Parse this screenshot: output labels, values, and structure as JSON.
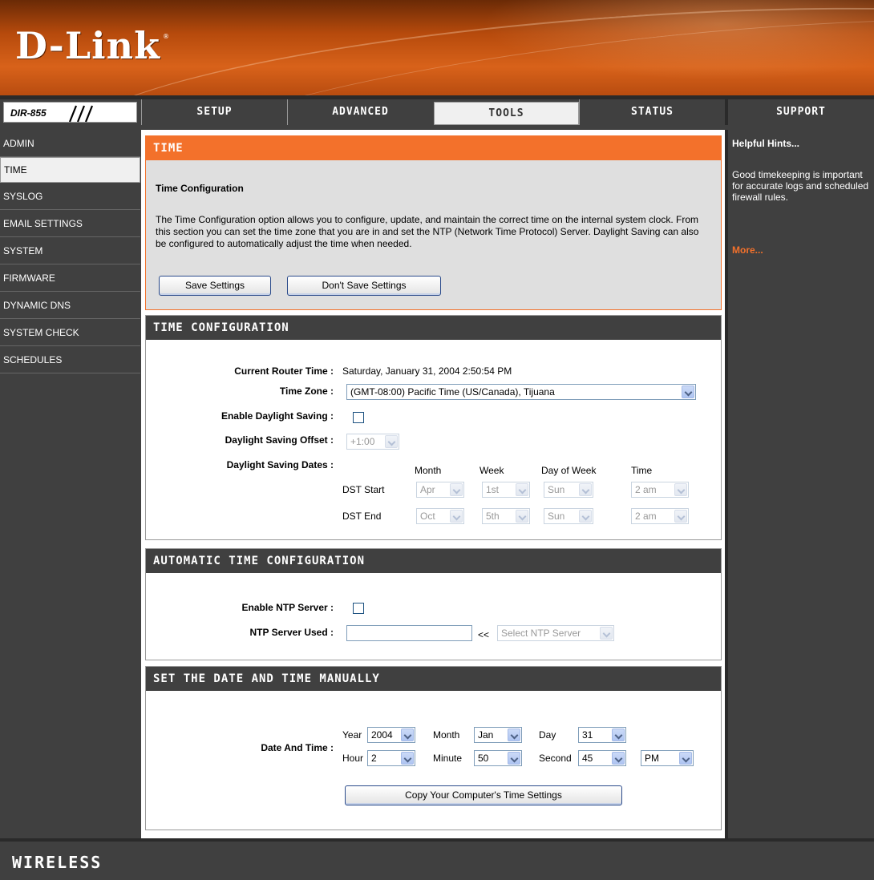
{
  "brand": {
    "logo": "D-Link",
    "registered": "®",
    "footer": "WIRELESS"
  },
  "model": {
    "name": "DIR-855"
  },
  "topnav": {
    "tabs": [
      "SETUP",
      "ADVANCED",
      "TOOLS",
      "STATUS",
      "SUPPORT"
    ],
    "active": "TOOLS"
  },
  "leftmenu": {
    "items": [
      "ADMIN",
      "TIME",
      "SYSLOG",
      "EMAIL SETTINGS",
      "SYSTEM",
      "FIRMWARE",
      "DYNAMIC DNS",
      "SYSTEM CHECK",
      "SCHEDULES"
    ],
    "active": "TIME"
  },
  "time_box": {
    "header": "TIME",
    "subtitle": "Time Configuration",
    "description": "The Time Configuration option allows you to configure, update, and maintain the correct time on the internal system clock. From this section you can set the time zone that you are in and set the NTP (Network Time Protocol) Server. Daylight Saving can also be configured to automatically adjust the time when needed.",
    "save_label": "Save Settings",
    "dont_save_label": "Don't Save Settings"
  },
  "time_config": {
    "header": "TIME CONFIGURATION",
    "current_time_label": "Current Router Time :",
    "current_time_value": "Saturday, January 31, 2004 2:50:54 PM",
    "timezone_label": "Time Zone :",
    "timezone_value": "(GMT-08:00) Pacific Time (US/Canada), Tijuana",
    "enable_dst_label": "Enable Daylight Saving :",
    "dst_offset_label": "Daylight Saving Offset :",
    "dst_offset_value": "+1:00",
    "dst_dates_label": "Daylight Saving Dates :",
    "col_month": "Month",
    "col_week": "Week",
    "col_dow": "Day of Week",
    "col_time": "Time",
    "dst_start_label": "DST Start",
    "dst_start": {
      "month": "Apr",
      "week": "1st",
      "dow": "Sun",
      "time": "2 am"
    },
    "dst_end_label": "DST End",
    "dst_end": {
      "month": "Oct",
      "week": "5th",
      "dow": "Sun",
      "time": "2 am"
    }
  },
  "ntp": {
    "header": "AUTOMATIC TIME CONFIGURATION",
    "enable_label": "Enable NTP Server :",
    "server_label": "NTP Server Used :",
    "server_value": "",
    "arrows": "<<",
    "select_placeholder": "Select NTP Server"
  },
  "manual": {
    "header": "SET THE DATE AND TIME MANUALLY",
    "label": "Date And Time :",
    "year_label": "Year",
    "year": "2004",
    "month_label": "Month",
    "month": "Jan",
    "day_label": "Day",
    "day": "31",
    "hour_label": "Hour",
    "hour": "2",
    "minute_label": "Minute",
    "minute": "50",
    "second_label": "Second",
    "second": "45",
    "ampm": "PM",
    "copy_label": "Copy Your Computer's Time Settings"
  },
  "hints": {
    "title": "Helpful Hints...",
    "text": "Good timekeeping is important for accurate logs and scheduled firewall rules.",
    "more": "More..."
  }
}
